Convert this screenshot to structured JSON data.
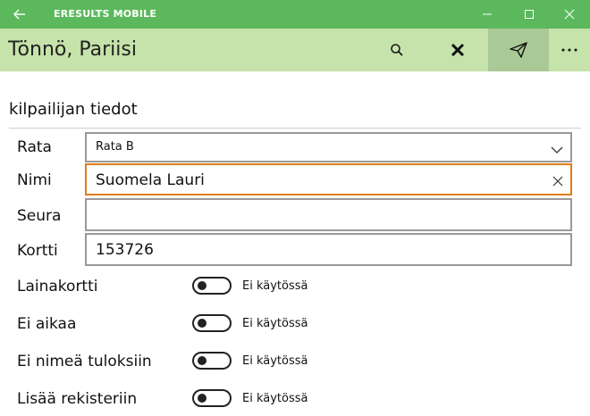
{
  "window": {
    "title": "ERESULTS MOBILE"
  },
  "appbar": {
    "title": "Tönnö, Pariisi"
  },
  "section": {
    "title": "kilpailijan tiedot"
  },
  "form": {
    "rata": {
      "label": "Rata",
      "value": "Rata B"
    },
    "nimi": {
      "label": "Nimi",
      "value": "Suomela Lauri"
    },
    "seura": {
      "label": "Seura",
      "value": ""
    },
    "kortti": {
      "label": "Kortti",
      "value": "153726"
    }
  },
  "toggles": [
    {
      "label": "Lainakortti",
      "state": "Ei käytössä"
    },
    {
      "label": "Ei aikaa",
      "state": "Ei käytössä"
    },
    {
      "label": "Ei nimeä tuloksiin",
      "state": "Ei käytössä"
    },
    {
      "label": "Lisää rekisteriin",
      "state": "Ei käytössä"
    }
  ],
  "colors": {
    "titlebar": "#5cb85c",
    "appbar": "#c5e3aa",
    "focus": "#e07d1a"
  },
  "icons": [
    "back-arrow-icon",
    "minimize-icon",
    "maximize-icon",
    "close-icon",
    "search-icon",
    "x-icon",
    "send-icon",
    "more-icon",
    "chevron-down-icon",
    "clear-icon"
  ]
}
